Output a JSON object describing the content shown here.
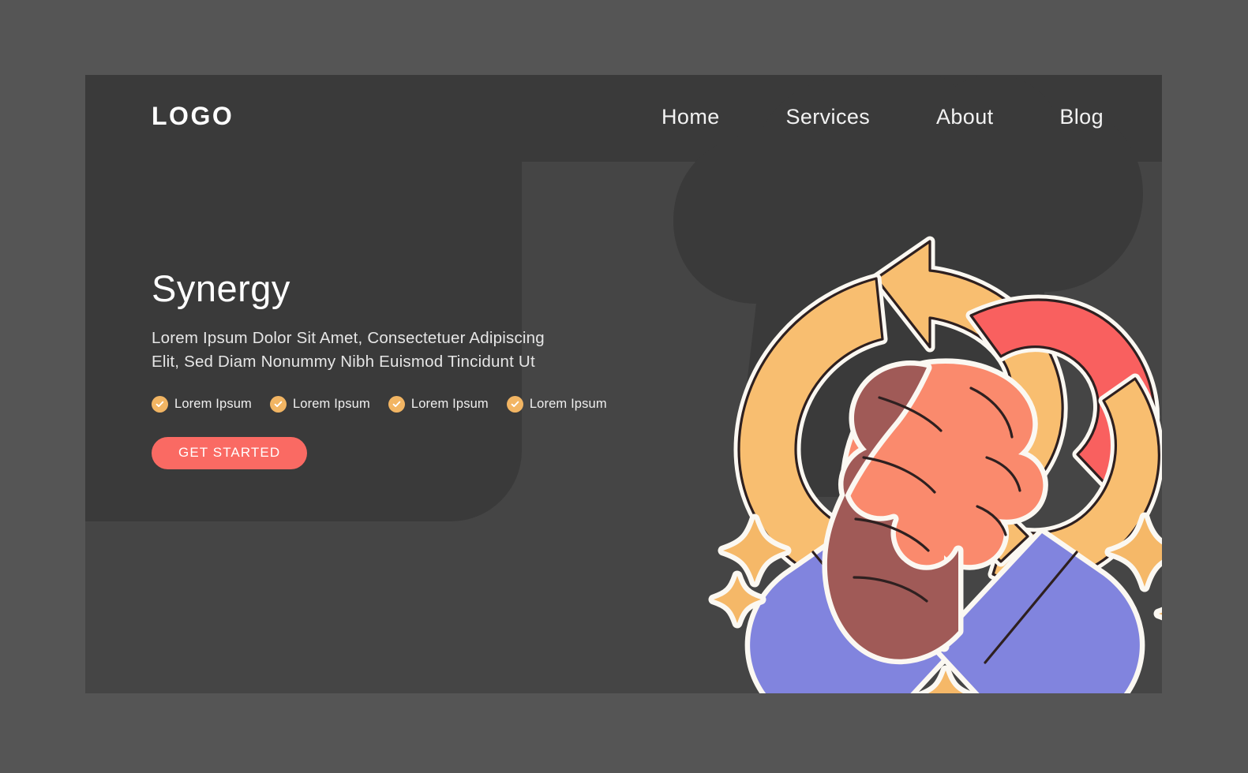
{
  "page": {
    "background_color": "#555555",
    "card_color": "#454545",
    "panel_color": "#3a3a3a"
  },
  "header": {
    "logo": "LOGO",
    "nav": [
      {
        "label": "Home",
        "name": "nav-item-home"
      },
      {
        "label": "Services",
        "name": "nav-item-services"
      },
      {
        "label": "About",
        "name": "nav-item-about"
      },
      {
        "label": "Blog",
        "name": "nav-item-blog"
      }
    ]
  },
  "hero": {
    "title": "Synergy",
    "subtitle_line1": "Lorem Ipsum Dolor Sit Amet, Consectetuer Adipiscing",
    "subtitle_line2": "Elit, Sed Diam Nonummy Nibh Euismod Tincidunt Ut",
    "features": [
      {
        "label": "Lorem Ipsum",
        "icon": "check-circle-icon"
      },
      {
        "label": "Lorem Ipsum",
        "icon": "check-circle-icon"
      },
      {
        "label": "Lorem Ipsum",
        "icon": "check-circle-icon"
      },
      {
        "label": "Lorem Ipsum",
        "icon": "check-circle-icon"
      }
    ],
    "cta_label": "GET STARTED",
    "cta_color": "#fa6a63",
    "check_badge_color": "#f2b563"
  },
  "illustration": {
    "name": "handshake-with-circular-arrows-illustration",
    "colors": {
      "arrow_orange": "#f8be70",
      "arrow_red": "#f9605f",
      "hand_light": "#fa8a6d",
      "hand_dark": "#a05a57",
      "sleeve_purple": "#8184de",
      "outline_white": "#fbf8f2",
      "line_dark": "#2e2020",
      "sparkle_orange": "#f5b868",
      "blob_dark": "#3a3a3a"
    },
    "elements": [
      "orange-circular-arrow",
      "red-circular-arrow",
      "dark-skin-hand",
      "light-skin-hand",
      "left-purple-sleeve",
      "right-purple-sleeve",
      "sparkle-star-1",
      "sparkle-star-2",
      "sparkle-star-3",
      "sparkle-star-4",
      "sparkle-star-5"
    ]
  }
}
